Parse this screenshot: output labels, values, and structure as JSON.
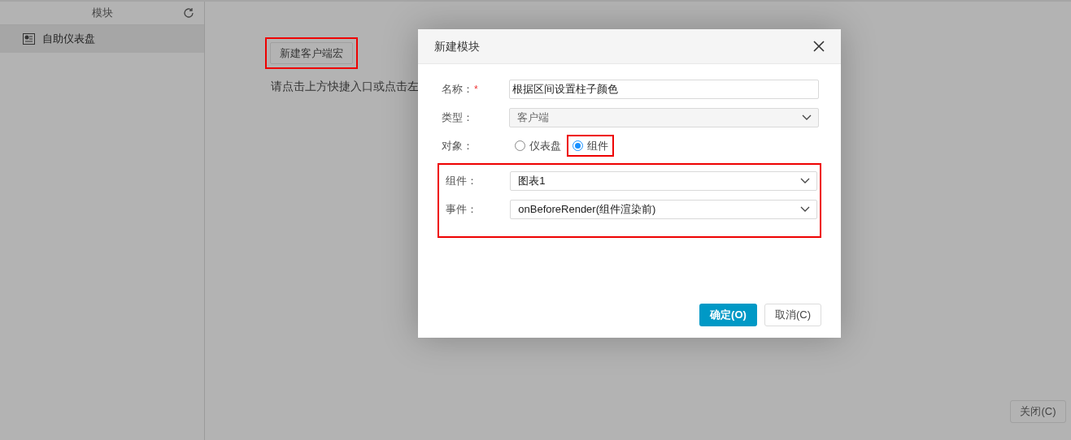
{
  "sidebar": {
    "title": "模块",
    "items": [
      {
        "label": "自助仪表盘",
        "selected": true
      }
    ]
  },
  "main": {
    "new_button": {
      "label": "新建客户端宏",
      "highlighted": true
    },
    "hint": "请点击上方快捷入口或点击左"
  },
  "dialog": {
    "title": "新建模块",
    "fields": [
      {
        "kind": "text",
        "label": "名称：",
        "required_mark": "*",
        "value": "根据区间设置柱子颜色"
      },
      {
        "kind": "select",
        "label": "类型：",
        "value": "客户端",
        "disabled": true
      },
      {
        "kind": "radio",
        "label": "对象：",
        "options": [
          {
            "label": "仪表盘",
            "selected": false,
            "highlighted": false
          },
          {
            "label": "组件",
            "selected": true,
            "highlighted": true
          }
        ]
      }
    ],
    "highlighted_fields": [
      {
        "kind": "select",
        "label": "组件：",
        "value": "图表1",
        "disabled": false
      },
      {
        "kind": "select",
        "label": "事件：",
        "value": "onBeforeRender(组件渲染前)",
        "disabled": false
      }
    ],
    "buttons": [
      {
        "label": "确定(O)",
        "primary": true
      },
      {
        "label": "取消(C)",
        "primary": false
      }
    ]
  },
  "footer_button": "关闭(C)"
}
